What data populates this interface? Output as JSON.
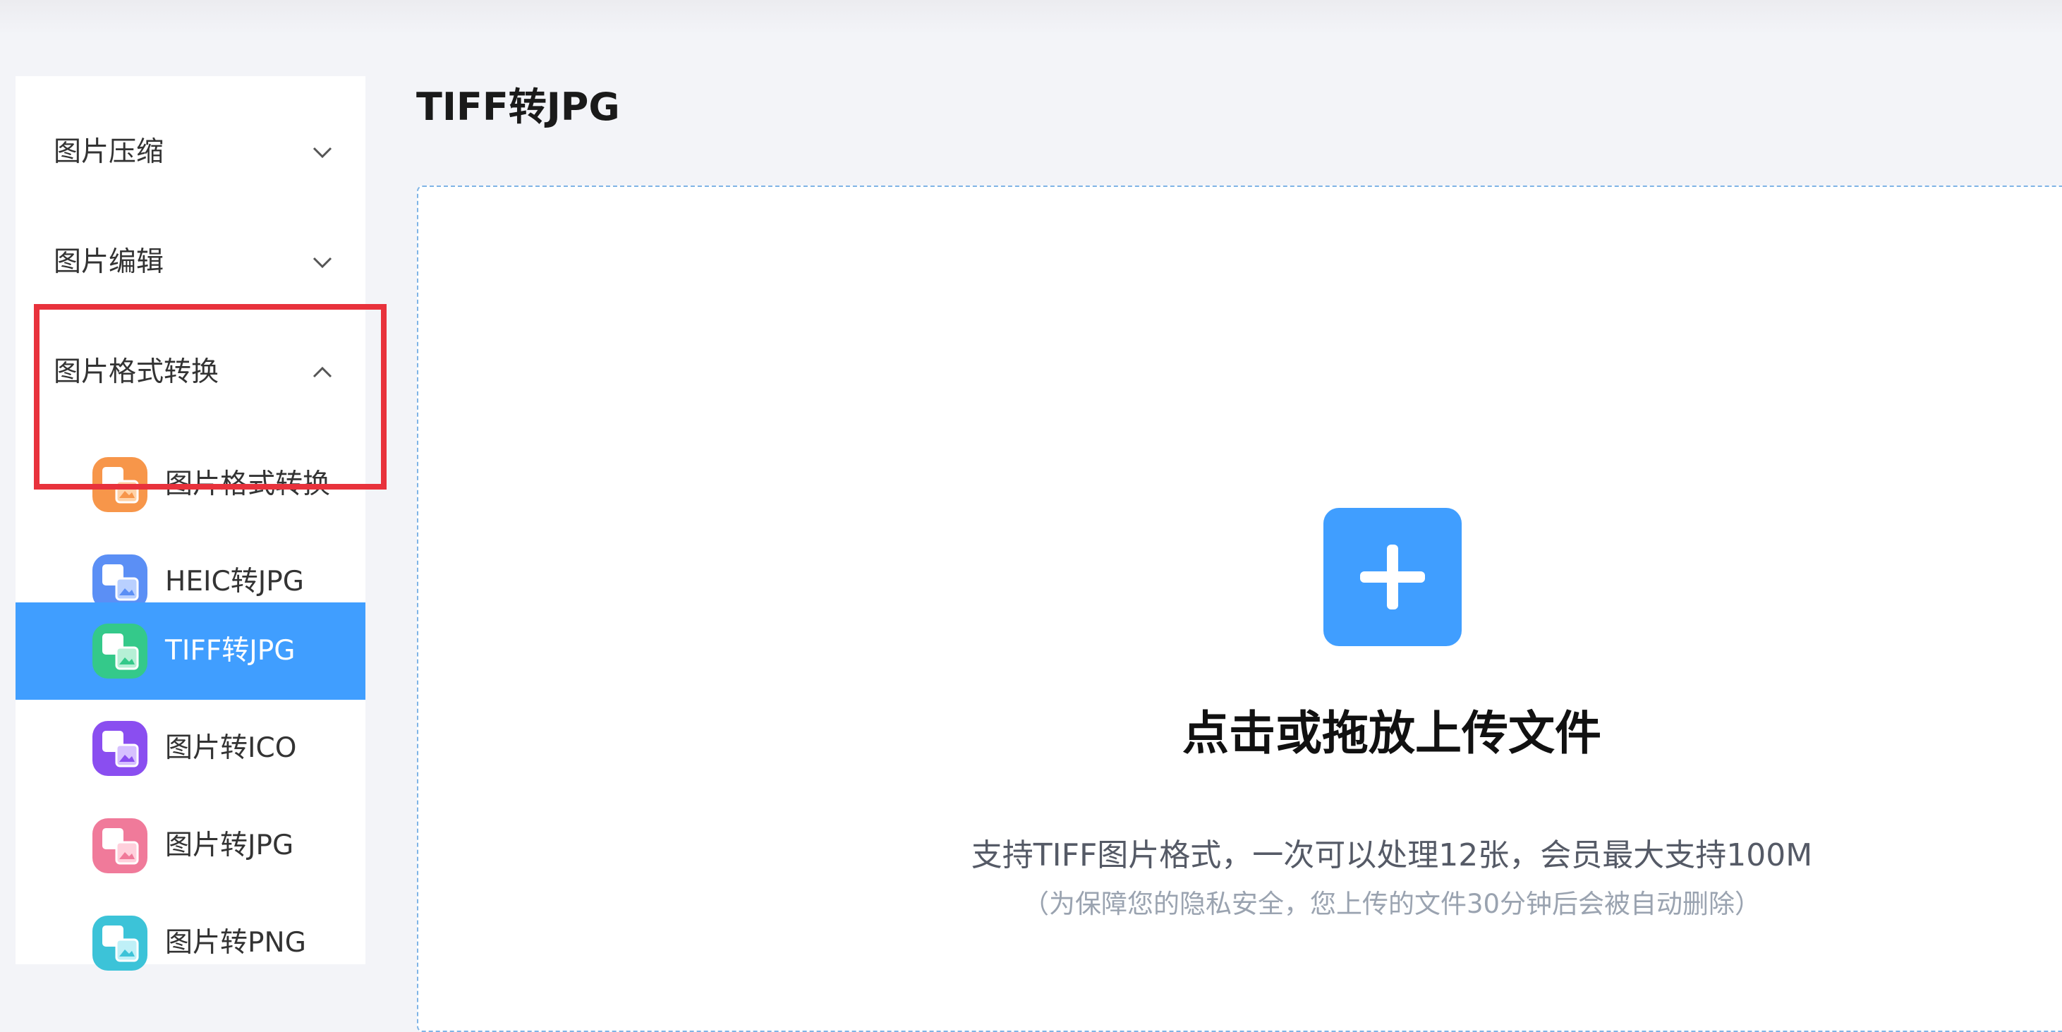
{
  "sidebar": {
    "groups": [
      {
        "label": "图片压缩",
        "expanded": false
      },
      {
        "label": "图片编辑",
        "expanded": false
      },
      {
        "label": "图片格式转换",
        "expanded": true
      }
    ],
    "items": [
      {
        "label": "图片格式转换",
        "icon": "image-convert-icon",
        "color": "#f7964a"
      },
      {
        "label": "HEIC转JPG",
        "icon": "heic-to-jpg-icon",
        "color": "#5b8ff5"
      },
      {
        "label": "TIFF转JPG",
        "icon": "tiff-to-jpg-icon",
        "color": "#34c98a",
        "active": true
      },
      {
        "label": "图片转ICO",
        "icon": "image-to-ico-icon",
        "color": "#8a4ef0"
      },
      {
        "label": "图片转JPG",
        "icon": "image-to-jpg-icon",
        "color": "#f07a9a"
      },
      {
        "label": "图片转PNG",
        "icon": "image-to-png-icon",
        "color": "#3cc3d8"
      }
    ],
    "highlight_color": "#e8323c",
    "active_color": "#409eff"
  },
  "main": {
    "title": "TIFF转JPG",
    "upload": {
      "button_icon": "plus-icon",
      "title": "点击或拖放上传文件",
      "description": "支持TIFF图片格式，一次可以处理12张，会员最大支持100M",
      "note": "（为保障您的隐私安全，您上传的文件30分钟后会被自动删除）"
    }
  }
}
